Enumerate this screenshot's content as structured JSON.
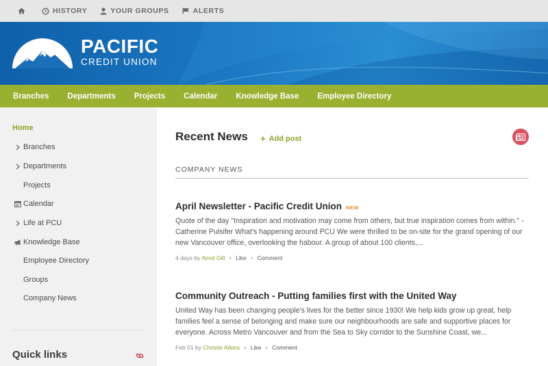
{
  "topbar": {
    "items": [
      {
        "icon": "home-icon",
        "label": ""
      },
      {
        "icon": "clock-icon",
        "label": "HISTORY"
      },
      {
        "icon": "user-icon",
        "label": "YOUR GROUPS"
      },
      {
        "icon": "flag-icon",
        "label": "ALERTS"
      }
    ]
  },
  "brand": {
    "line1": "PACIFIC",
    "line2": "CREDIT UNION"
  },
  "nav": {
    "items": [
      "Branches",
      "Departments",
      "Projects",
      "Calendar",
      "Knowledge Base",
      "Employee Directory"
    ]
  },
  "sidebar": {
    "items": [
      {
        "label": "Home",
        "icon": ""
      },
      {
        "label": "Branches",
        "icon": "chevron-right-icon"
      },
      {
        "label": "Departments",
        "icon": "chevron-right-icon"
      },
      {
        "label": "Projects",
        "icon": ""
      },
      {
        "label": "Calendar",
        "icon": "calendar-icon"
      },
      {
        "label": "Life at PCU",
        "icon": "chevron-right-icon"
      },
      {
        "label": "Knowledge Base",
        "icon": "bullhorn-icon"
      },
      {
        "label": "Employee Directory",
        "icon": ""
      },
      {
        "label": "Groups",
        "icon": ""
      },
      {
        "label": "Company News",
        "icon": ""
      }
    ],
    "quicklinks_title": "Quick links"
  },
  "main": {
    "title": "Recent News",
    "add_post": "Add post",
    "section_label": "COMPANY NEWS",
    "posts": [
      {
        "title": "April Newsletter - Pacific Credit Union",
        "badge": "NEW",
        "excerpt": "Quote of the day \"Inspiration and motivation may come from others, but true inspiration comes from within.\" - Catherine Pulsifer What's happening around PCU We were thrilled to be on-site for the grand opening of our new Vancouver office, overlooking the habour. A group of about 100 clients,...",
        "time": "4 days",
        "by": "by",
        "author": "Amol Gill",
        "like": "Like",
        "comment": "Comment"
      },
      {
        "title": "Community Outreach - Putting families first with the United Way",
        "badge": "",
        "excerpt": "United Way has been changing people's lives for the better since 1930! We help kids grow up great, help families feel a sense of belonging and make sure our neighbourhoods are safe and supportive places for everyone. Across Metro Vancouver and from the Sea to Sky corridor to the Sunshine Coast, we...",
        "time": "Feb 01",
        "by": "by",
        "author": "Christie Atkins",
        "like": "Like",
        "comment": "Comment"
      }
    ]
  },
  "colors": {
    "accent_green": "#99b030",
    "banner_blue": "#1a6fb8",
    "rss_red": "#d9505f",
    "badge_orange": "#e08a2e"
  }
}
